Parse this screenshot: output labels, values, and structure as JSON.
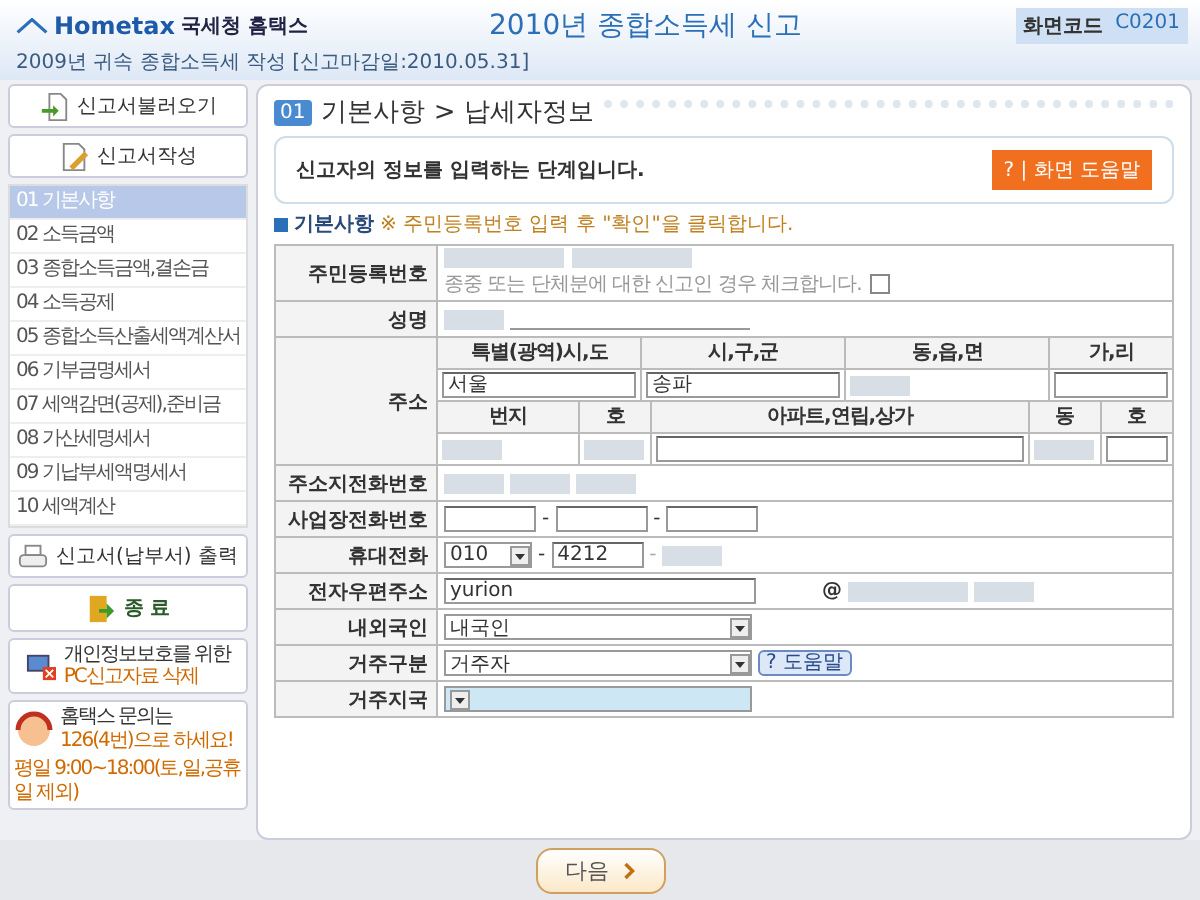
{
  "header": {
    "logo": "Hometax",
    "org": "국세청 홈택스",
    "title": "2010년 종합소득세 신고",
    "code_label": "화면코드",
    "code": "C0201",
    "subtitle": "2009년 귀속 종합소득세 작성 [신고마감일:2010.05.31]"
  },
  "sidebar": {
    "top_buttons": [
      {
        "kind": "load",
        "label": "신고서불러오기"
      },
      {
        "kind": "write",
        "label": "신고서작성"
      }
    ],
    "menu": [
      {
        "label": "01 기본사항",
        "selected": true
      },
      {
        "label": "02 소득금액",
        "selected": false
      },
      {
        "label": "03 종합소득금액,결손금",
        "selected": false
      },
      {
        "label": "04 소득공제",
        "selected": false
      },
      {
        "label": "05 종합소득산출세액계산서",
        "selected": false
      },
      {
        "label": "06 기부금명세서",
        "selected": false
      },
      {
        "label": "07 세액감면(공제),준비금",
        "selected": false
      },
      {
        "label": "08 가산세명세서",
        "selected": false
      },
      {
        "label": "09 기납부세액명세서",
        "selected": false
      },
      {
        "label": "10 세액계산",
        "selected": false
      }
    ],
    "print_button": "신고서(납부서) 출력",
    "exit_button": "종 료",
    "pc_notice": {
      "line1": "개인정보보호를 위한",
      "line2": "PC신고자료 삭제"
    },
    "contact": {
      "line1": "홈택스 문의는",
      "line2": "126(4번)으로 하세요!",
      "hours": "평일 9:00~18:00(토,일,공휴일 제외)"
    }
  },
  "main": {
    "step": "01",
    "breadcrumb": "기본사항 > 납세자정보",
    "intro": "신고자의 정보를 입력하는 단계입니다.",
    "help_button": "? | 화면 도움말",
    "note_section": "기본사항",
    "note": "※ 주민등록번호 입력 후 \"확인\"을 클릭합니다.",
    "resident": {
      "label": "주민등록번호",
      "group_note": "종중 또는 단체분에 대한 신고인 경우 체크합니다.",
      "checked": false
    },
    "name_label": "성명",
    "address": {
      "label": "주소",
      "headers1": [
        "특별(광역)시,도",
        "시,구,군",
        "동,읍,면",
        "가,리"
      ],
      "fields1": [
        {
          "kind": "text",
          "value": "서울"
        },
        {
          "kind": "text",
          "value": "송파"
        },
        {
          "kind": "redacted"
        },
        {
          "kind": "empty"
        }
      ],
      "headers2": [
        "번지",
        "호",
        "아파트,연립,상가",
        "동",
        "호"
      ],
      "fields2": [
        {
          "kind": "redacted"
        },
        {
          "kind": "redacted"
        },
        {
          "kind": "empty"
        },
        {
          "kind": "redacted"
        },
        {
          "kind": "empty"
        }
      ]
    },
    "rows": [
      {
        "kind": "redacted",
        "label": "주소지전화번호"
      },
      {
        "kind": "phone",
        "label": "사업장전화번호",
        "separators": [
          "-",
          "-"
        ]
      },
      {
        "kind": "mobile",
        "label": "휴대전화",
        "prefix": "010",
        "middle": "4212",
        "separators": [
          "-",
          "-"
        ]
      },
      {
        "kind": "email",
        "label": "전자우편주소",
        "user": "yurion",
        "at": "@"
      },
      {
        "kind": "select",
        "label": "내외국인",
        "value": "내국인",
        "disabled": false
      },
      {
        "kind": "select",
        "label": "거주구분",
        "value": "거주자",
        "disabled": false,
        "help": "? 도움말"
      },
      {
        "kind": "select",
        "label": "거주지국",
        "disabled": true
      }
    ]
  },
  "next_button": "다음"
}
